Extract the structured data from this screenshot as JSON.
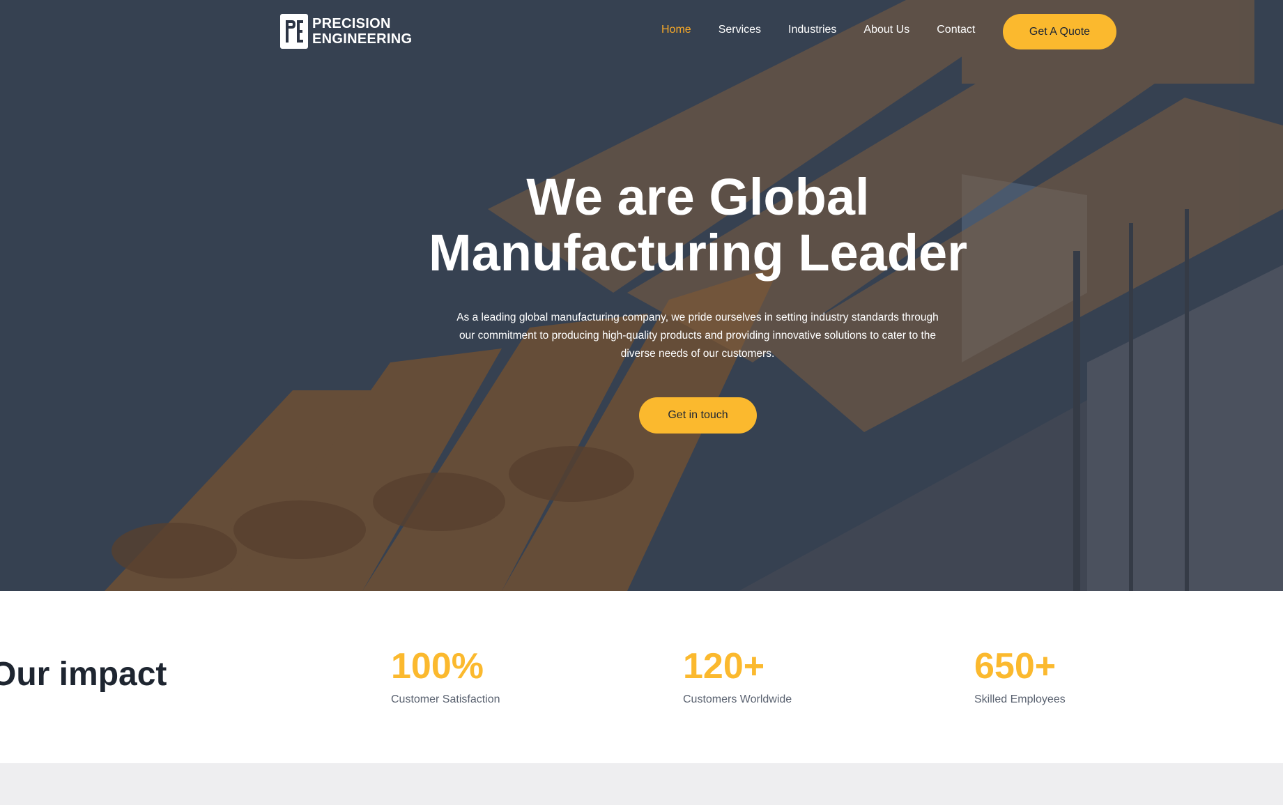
{
  "brand": {
    "logo_line1": "PRECISION",
    "logo_line2": "ENGINEERING",
    "accent_color": "#fbb92e",
    "active_link_color": "#f7a928",
    "hero_overlay_color": "#3a4456"
  },
  "nav": {
    "links": [
      {
        "label": "Home",
        "active": true
      },
      {
        "label": "Services",
        "active": false
      },
      {
        "label": "Industries",
        "active": false
      },
      {
        "label": "About Us",
        "active": false
      },
      {
        "label": "Contact",
        "active": false
      }
    ],
    "quote_label": "Get A Quote"
  },
  "hero": {
    "title_line1": "We are Global",
    "title_line2": "Manufacturing Leader",
    "description": "As a leading global manufacturing company, we pride ourselves in setting industry standards through our commitment to producing high-quality products and providing innovative solutions to cater to the diverse needs of our customers.",
    "cta_label": "Get in touch"
  },
  "impact": {
    "title": "Our impact",
    "stats": [
      {
        "value": "100%",
        "label": "Customer Satisfaction"
      },
      {
        "value": "120+",
        "label": "Customers Worldwide"
      },
      {
        "value": "650+",
        "label": "Skilled Employees"
      }
    ]
  }
}
